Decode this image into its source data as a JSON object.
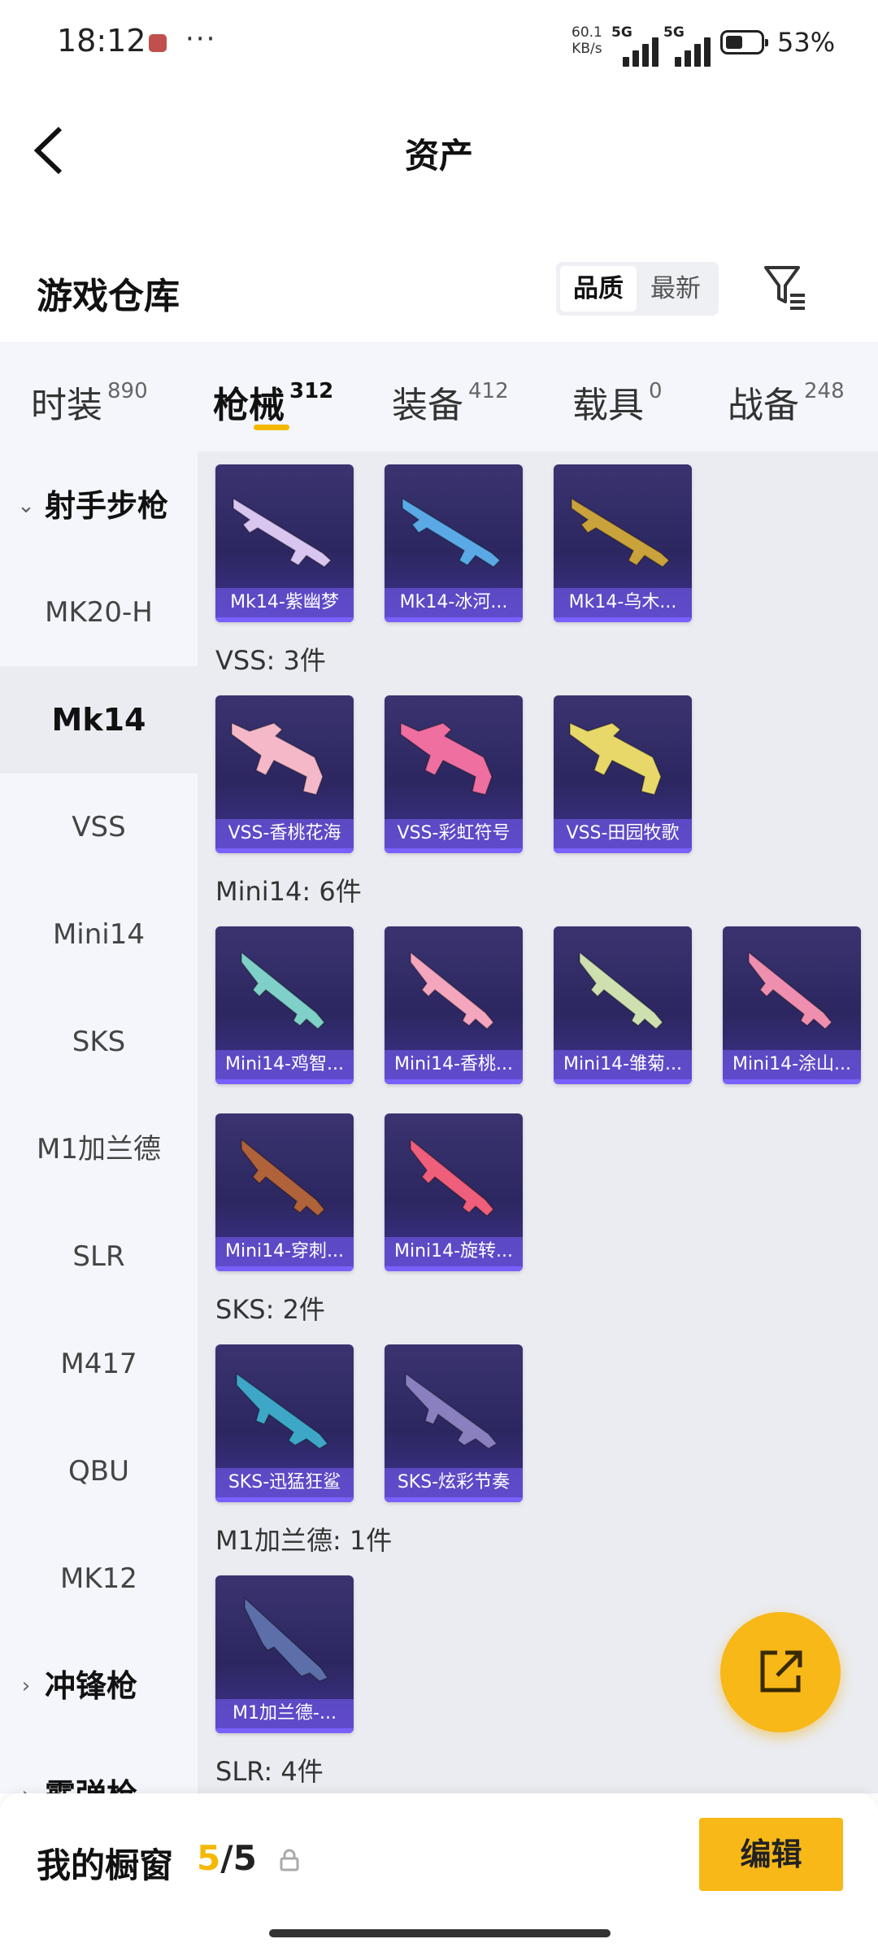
{
  "status_bar": {
    "time": "18:12",
    "more": "···",
    "net_speed": "60.1",
    "net_unit": "KB/s",
    "signal1": "5G",
    "signal2": "5G",
    "battery": "53%"
  },
  "header": {
    "title": "资产",
    "back_icon": "chevron-left-icon"
  },
  "warehouse": {
    "title": "游戏仓库",
    "sort_options": [
      "品质",
      "最新"
    ],
    "active_sort": "品质",
    "filter_icon": "filter-icon"
  },
  "tabs": [
    {
      "label": "时装",
      "count": "890"
    },
    {
      "label": "枪械",
      "count": "312",
      "active": true
    },
    {
      "label": "装备",
      "count": "412"
    },
    {
      "label": "载具",
      "count": "0"
    },
    {
      "label": "战备",
      "count": "248"
    }
  ],
  "sidebar": {
    "category_expanded": "射手步枪",
    "items": [
      "MK20-H",
      "Mk14",
      "VSS",
      "Mini14",
      "SKS",
      "M1加兰德",
      "SLR",
      "M417",
      "QBU",
      "MK12"
    ],
    "active_item": "Mk14",
    "category_collapsed_1": "冲锋枪",
    "category_collapsed_2": "霰弹枪"
  },
  "groups": [
    {
      "label": "",
      "items": [
        "Mk14-紫幽梦",
        "Mk14-冰河...",
        "Mk14-乌木..."
      ]
    },
    {
      "label": "VSS: 3件",
      "items": [
        "VSS-香桃花海",
        "VSS-彩虹符号",
        "VSS-田园牧歌"
      ]
    },
    {
      "label": "Mini14: 6件",
      "items": [
        "Mini14-鸡智...",
        "Mini14-香桃...",
        "Mini14-雏菊...",
        "Mini14-涂山...",
        "Mini14-穿刺...",
        "Mini14-旋转..."
      ]
    },
    {
      "label": "SKS: 2件",
      "items": [
        "SKS-迅猛狂鲨",
        "SKS-炫彩节奏"
      ]
    },
    {
      "label": "M1加兰德: 1件",
      "items": [
        "M1加兰德-..."
      ]
    },
    {
      "label": "SLR: 4件",
      "items": []
    }
  ],
  "gun_colors": [
    "#d9c6f0",
    "#5aa9e6",
    "#caa23b",
    "#f4b8c8",
    "#ef6fa0",
    "#e8d86a",
    "#7ed0c8",
    "#f3a6bd",
    "#cfe0b0",
    "#ef8fb0",
    "#b0623a",
    "#ef5e7a",
    "#3ea7c7",
    "#8a7fbf",
    "#5c6fa8"
  ],
  "fab": {
    "icon": "share-icon"
  },
  "bottom_bar": {
    "showcase_label": "我的橱窗",
    "current": "5",
    "separator": "/",
    "total": "5",
    "lock_icon": "lock-icon",
    "edit_label": "编辑"
  },
  "accent": "#f5b800"
}
